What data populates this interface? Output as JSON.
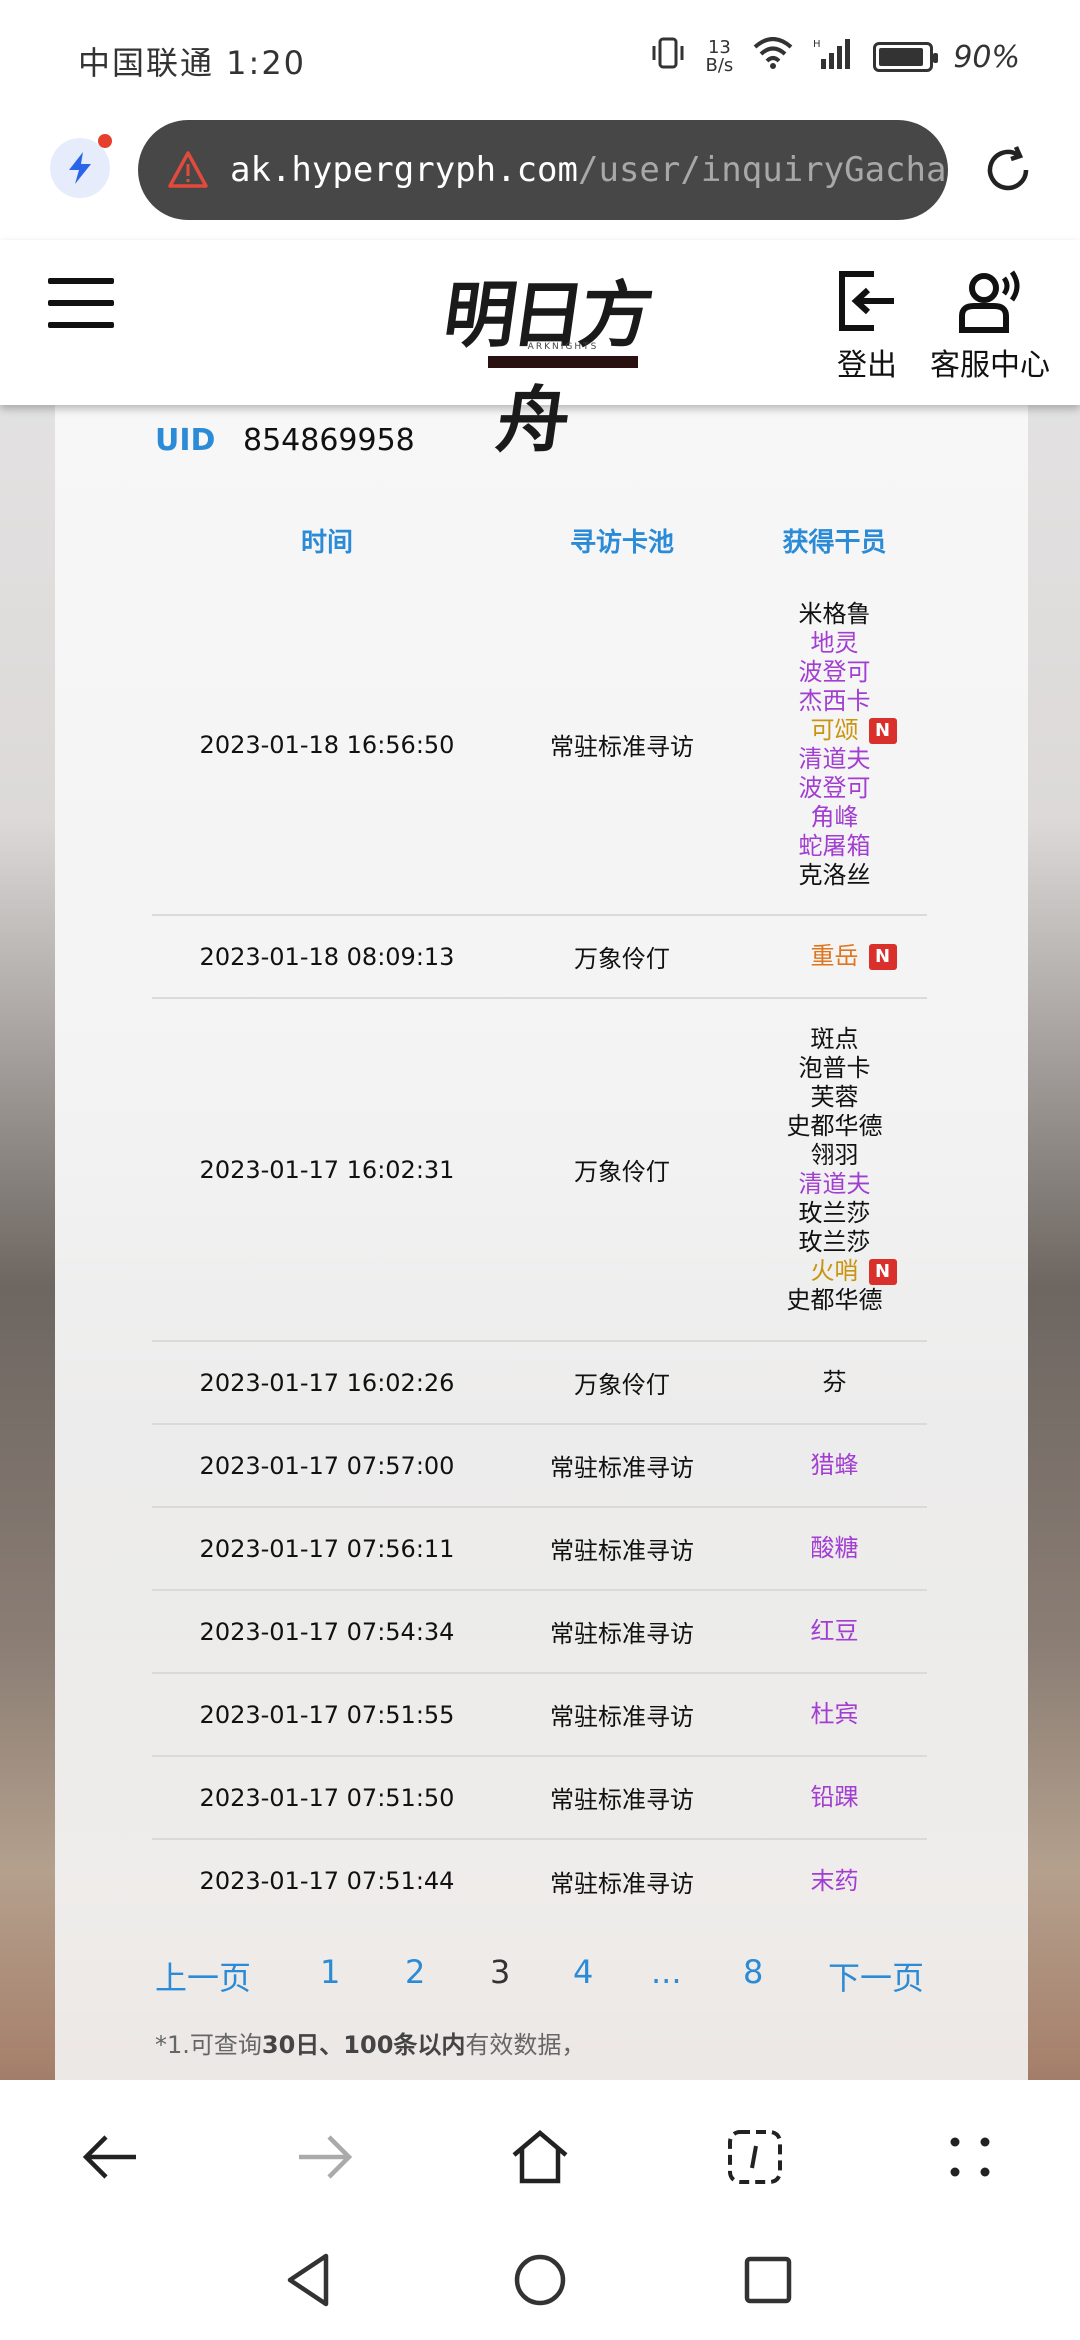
{
  "status_bar": {
    "carrier_time": "中国联通 1:20",
    "net_speed_value": "13",
    "net_speed_unit": "B/s",
    "battery": "90%"
  },
  "browser": {
    "url_domain": "ak.hypergryph.com",
    "url_path": "/user/inquiryGacha"
  },
  "header": {
    "logo_text": "明日方舟",
    "logo_sub": "ARKNIGHTS",
    "logout_label": "登出",
    "service_label": "客服中心"
  },
  "uid": {
    "label": "UID",
    "value": "854869958"
  },
  "table": {
    "headers": [
      "时间",
      "寻访卡池",
      "获得干员"
    ],
    "rows": [
      {
        "time": "2023-01-18 16:56:50",
        "pool": "常驻标准寻访",
        "ops": [
          {
            "name": "米格鲁",
            "rarity": "3",
            "new": false
          },
          {
            "name": "地灵",
            "rarity": "4",
            "new": false
          },
          {
            "name": "波登可",
            "rarity": "4",
            "new": false
          },
          {
            "name": "杰西卡",
            "rarity": "4",
            "new": false
          },
          {
            "name": "可颂",
            "rarity": "5",
            "new": true
          },
          {
            "name": "清道夫",
            "rarity": "4",
            "new": false
          },
          {
            "name": "波登可",
            "rarity": "4",
            "new": false
          },
          {
            "name": "角峰",
            "rarity": "4",
            "new": false
          },
          {
            "name": "蛇屠箱",
            "rarity": "4",
            "new": false
          },
          {
            "name": "克洛丝",
            "rarity": "3",
            "new": false
          }
        ]
      },
      {
        "time": "2023-01-18 08:09:13",
        "pool": "万象伶仃",
        "ops": [
          {
            "name": "重岳",
            "rarity": "6",
            "new": true
          }
        ]
      },
      {
        "time": "2023-01-17 16:02:31",
        "pool": "万象伶仃",
        "ops": [
          {
            "name": "斑点",
            "rarity": "3",
            "new": false
          },
          {
            "name": "泡普卡",
            "rarity": "3",
            "new": false
          },
          {
            "name": "芙蓉",
            "rarity": "3",
            "new": false
          },
          {
            "name": "史都华德",
            "rarity": "3",
            "new": false
          },
          {
            "name": "翎羽",
            "rarity": "3",
            "new": false
          },
          {
            "name": "清道夫",
            "rarity": "4",
            "new": false
          },
          {
            "name": "玫兰莎",
            "rarity": "3",
            "new": false
          },
          {
            "name": "玫兰莎",
            "rarity": "3",
            "new": false
          },
          {
            "name": "火哨",
            "rarity": "5",
            "new": true
          },
          {
            "name": "史都华德",
            "rarity": "3",
            "new": false
          }
        ]
      },
      {
        "time": "2023-01-17 16:02:26",
        "pool": "万象伶仃",
        "ops": [
          {
            "name": "芬",
            "rarity": "3",
            "new": false
          }
        ]
      },
      {
        "time": "2023-01-17 07:57:00",
        "pool": "常驻标准寻访",
        "ops": [
          {
            "name": "猎蜂",
            "rarity": "4",
            "new": false
          }
        ]
      },
      {
        "time": "2023-01-17 07:56:11",
        "pool": "常驻标准寻访",
        "ops": [
          {
            "name": "酸糖",
            "rarity": "4",
            "new": false
          }
        ]
      },
      {
        "time": "2023-01-17 07:54:34",
        "pool": "常驻标准寻访",
        "ops": [
          {
            "name": "红豆",
            "rarity": "4",
            "new": false
          }
        ]
      },
      {
        "time": "2023-01-17 07:51:55",
        "pool": "常驻标准寻访",
        "ops": [
          {
            "name": "杜宾",
            "rarity": "4",
            "new": false
          }
        ]
      },
      {
        "time": "2023-01-17 07:51:50",
        "pool": "常驻标准寻访",
        "ops": [
          {
            "name": "铅踝",
            "rarity": "4",
            "new": false
          }
        ]
      },
      {
        "time": "2023-01-17 07:51:44",
        "pool": "常驻标准寻访",
        "ops": [
          {
            "name": "末药",
            "rarity": "4",
            "new": false
          }
        ]
      }
    ],
    "new_badge": "N"
  },
  "pager": {
    "prev": "上一页",
    "pages": [
      "1",
      "2",
      "3",
      "4",
      "...",
      "8"
    ],
    "current": "3",
    "next": "下一页"
  },
  "note": {
    "prefix": "*1.可查询",
    "bold": "30日、100条以内",
    "suffix": "有效数据，"
  },
  "colors": {
    "rarity_3": "#111111",
    "rarity_4": "#a23ed1",
    "rarity_5": "#c9940e",
    "rarity_6": "#e0751f",
    "accent": "#2b8bd6",
    "new_badge": "#d9302c"
  },
  "icons": {
    "browser": [
      "bolt-icon",
      "warning-icon",
      "reload-icon"
    ],
    "header": [
      "menu-icon",
      "logout-icon",
      "customer-service-icon"
    ],
    "toolbar": [
      "back-arrow-icon",
      "forward-arrow-icon",
      "home-icon",
      "tabs-icon",
      "more-icon"
    ],
    "system": [
      "nav-back-icon",
      "nav-home-icon",
      "nav-recents-icon"
    ]
  }
}
